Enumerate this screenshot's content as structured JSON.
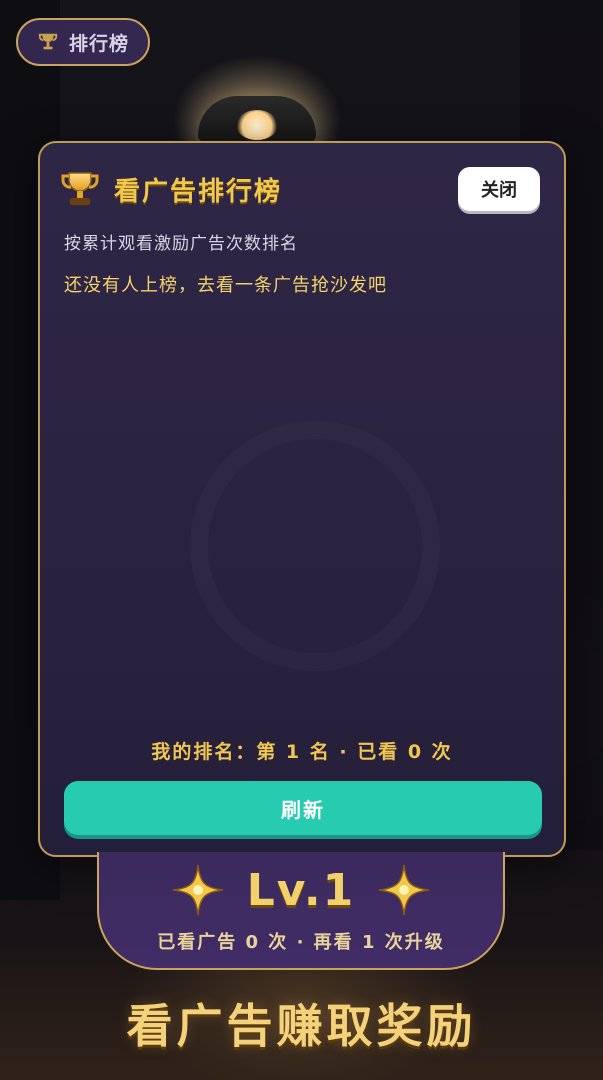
{
  "top_pill": {
    "label": "排行榜",
    "icon": "trophy-icon"
  },
  "modal": {
    "title": "看广告排行榜",
    "close_label": "关闭",
    "subtitle": "按累计观看激励广告次数排名",
    "empty_message": "还没有人上榜，去看一条广告抢沙发吧",
    "my_rank": "我的排名：第 1 名 · 已看 0 次",
    "refresh_label": "刷新"
  },
  "level_card": {
    "level": "Lv.1",
    "stats": "已看广告 0 次 · 再看 1 次升级"
  },
  "bottom_title": "看广告赚取奖励",
  "colors": {
    "accent_gold": "#f2c84b",
    "refresh_teal": "#27cbb0",
    "modal_bg": "#2a2340",
    "border_gold": "#bf9b55"
  }
}
